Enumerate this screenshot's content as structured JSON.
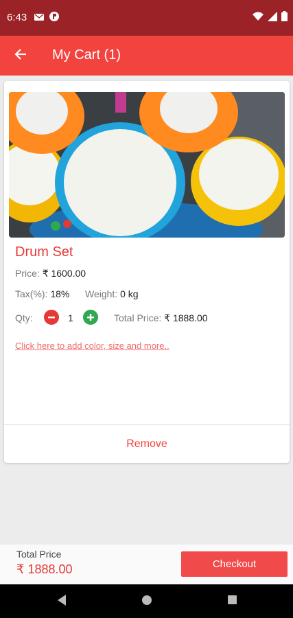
{
  "status_bar": {
    "time": "6:43"
  },
  "app_bar": {
    "title": "My Cart (1)"
  },
  "product": {
    "name": "Drum Set",
    "price_label": "Price:",
    "price_value": "₹ 1600.00",
    "tax_label": "Tax(%):",
    "tax_value": "18%",
    "weight_label": "Weight:",
    "weight_value": "0 kg",
    "qty_label": "Qty:",
    "qty_value": "1",
    "total_label": "Total Price:",
    "total_value": "₹ 1888.00",
    "options_link": "Click here to add color, size and more..",
    "remove_label": "Remove"
  },
  "footer": {
    "total_caption": "Total Price",
    "total_amount": "₹ 1888.00",
    "checkout_label": "Checkout"
  },
  "colors": {
    "primary": "#f2433f",
    "status": "#9b2226",
    "plus": "#2fa84f"
  },
  "icons": [
    "back-arrow-icon",
    "mail-icon",
    "app-notification-icon",
    "wifi-icon",
    "signal-icon",
    "battery-icon",
    "nav-back-icon",
    "nav-home-icon",
    "nav-recents-icon"
  ]
}
